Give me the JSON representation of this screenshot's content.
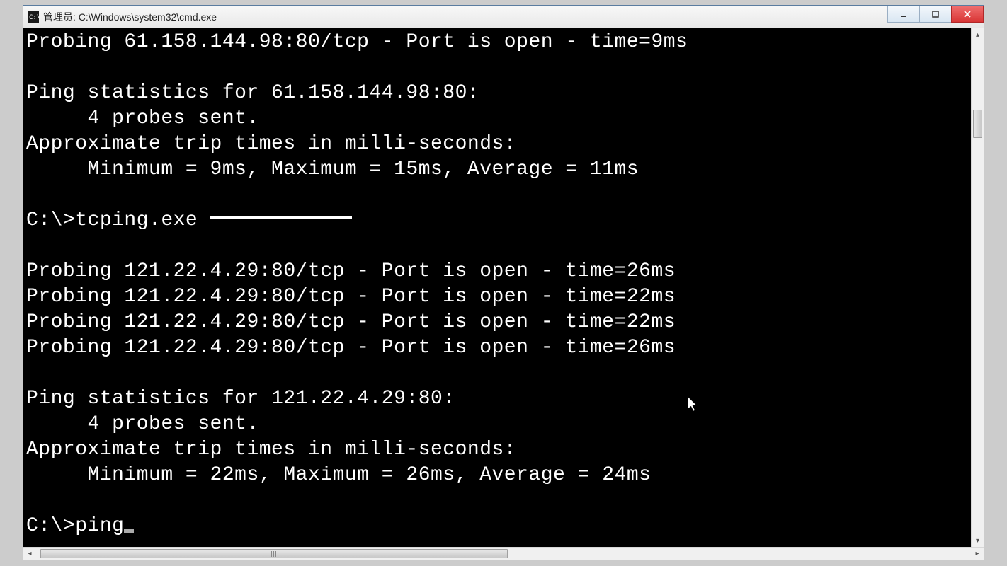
{
  "window": {
    "title": "管理员: C:\\Windows\\system32\\cmd.exe"
  },
  "terminal": {
    "lines": {
      "l0": "Probing 61.158.144.98:80/tcp - Port is open - time=9ms",
      "l1": "",
      "l2": "Ping statistics for 61.158.144.98:80:",
      "l3": "     4 probes sent.",
      "l4": "Approximate trip times in milli-seconds:",
      "l5": "     Minimum = 9ms, Maximum = 15ms, Average = 11ms",
      "l6": "",
      "l7a": "C:\\>tcping.exe ",
      "l8": "",
      "l9": "Probing 121.22.4.29:80/tcp - Port is open - time=26ms",
      "l10": "Probing 121.22.4.29:80/tcp - Port is open - time=22ms",
      "l11": "Probing 121.22.4.29:80/tcp - Port is open - time=22ms",
      "l12": "Probing 121.22.4.29:80/tcp - Port is open - time=26ms",
      "l13": "",
      "l14": "Ping statistics for 121.22.4.29:80:",
      "l15": "     4 probes sent.",
      "l16": "Approximate trip times in milli-seconds:",
      "l17": "     Minimum = 22ms, Maximum = 26ms, Average = 24ms",
      "l18": "",
      "l19": "C:\\>ping"
    }
  }
}
